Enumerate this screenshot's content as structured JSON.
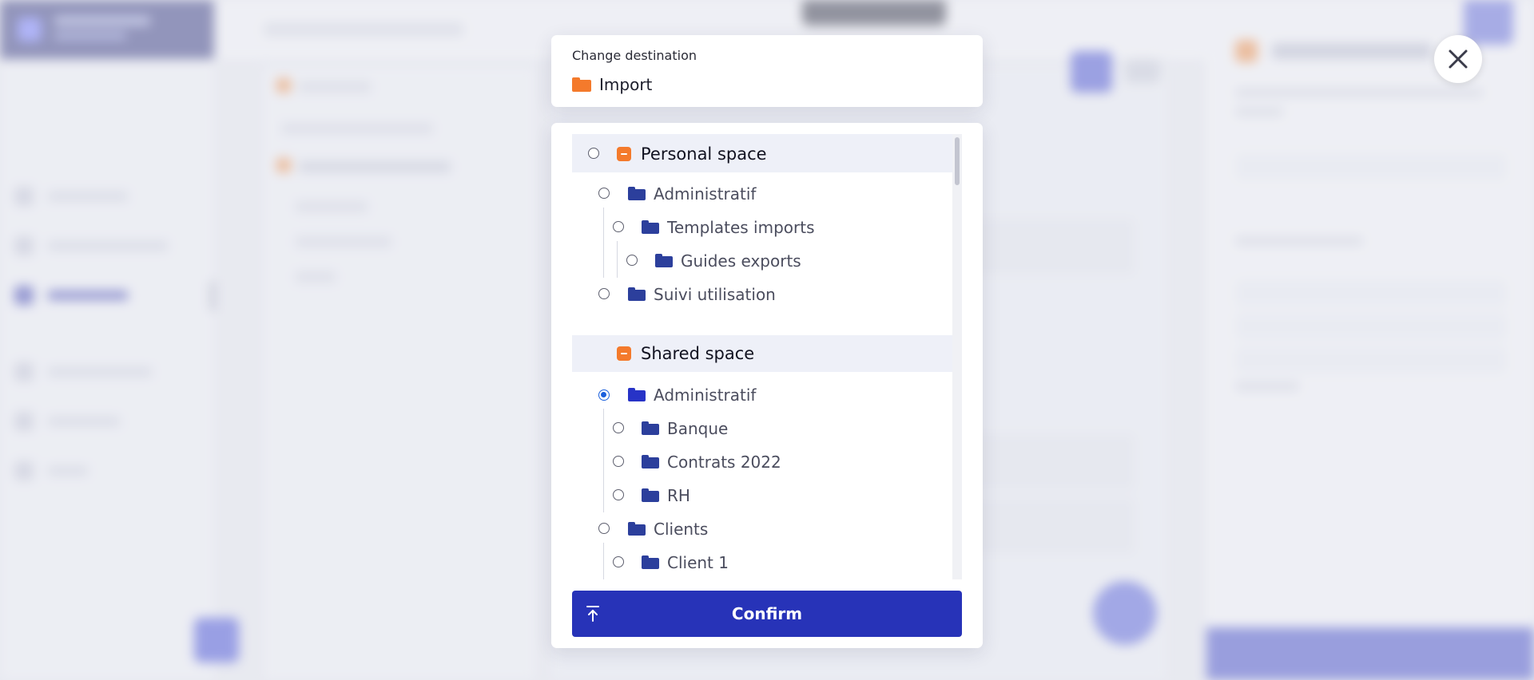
{
  "modal": {
    "destination_label": "Change destination",
    "destination_value": "Import",
    "confirm_label": "Confirm",
    "close_icon": "close-icon",
    "confirm_icon": "upload-icon"
  },
  "tree": {
    "personal": {
      "label": "Personal space",
      "children": {
        "administratif": "Administratif",
        "templates_imports": "Templates imports",
        "guides_exports": "Guides exports",
        "suivi_utilisation": "Suivi utilisation"
      }
    },
    "shared": {
      "label": "Shared space",
      "children": {
        "administratif": "Administratif",
        "banque": "Banque",
        "contrats_2022": "Contrats 2022",
        "rh": "RH",
        "clients": "Clients",
        "client_1": "Client 1"
      },
      "selected": "Administratif"
    }
  },
  "colors": {
    "accent": "#2733b8",
    "folder_blue": "#2c3f9c",
    "folder_orange": "#f47a2c",
    "radio_checked": "#1a5fdc"
  }
}
